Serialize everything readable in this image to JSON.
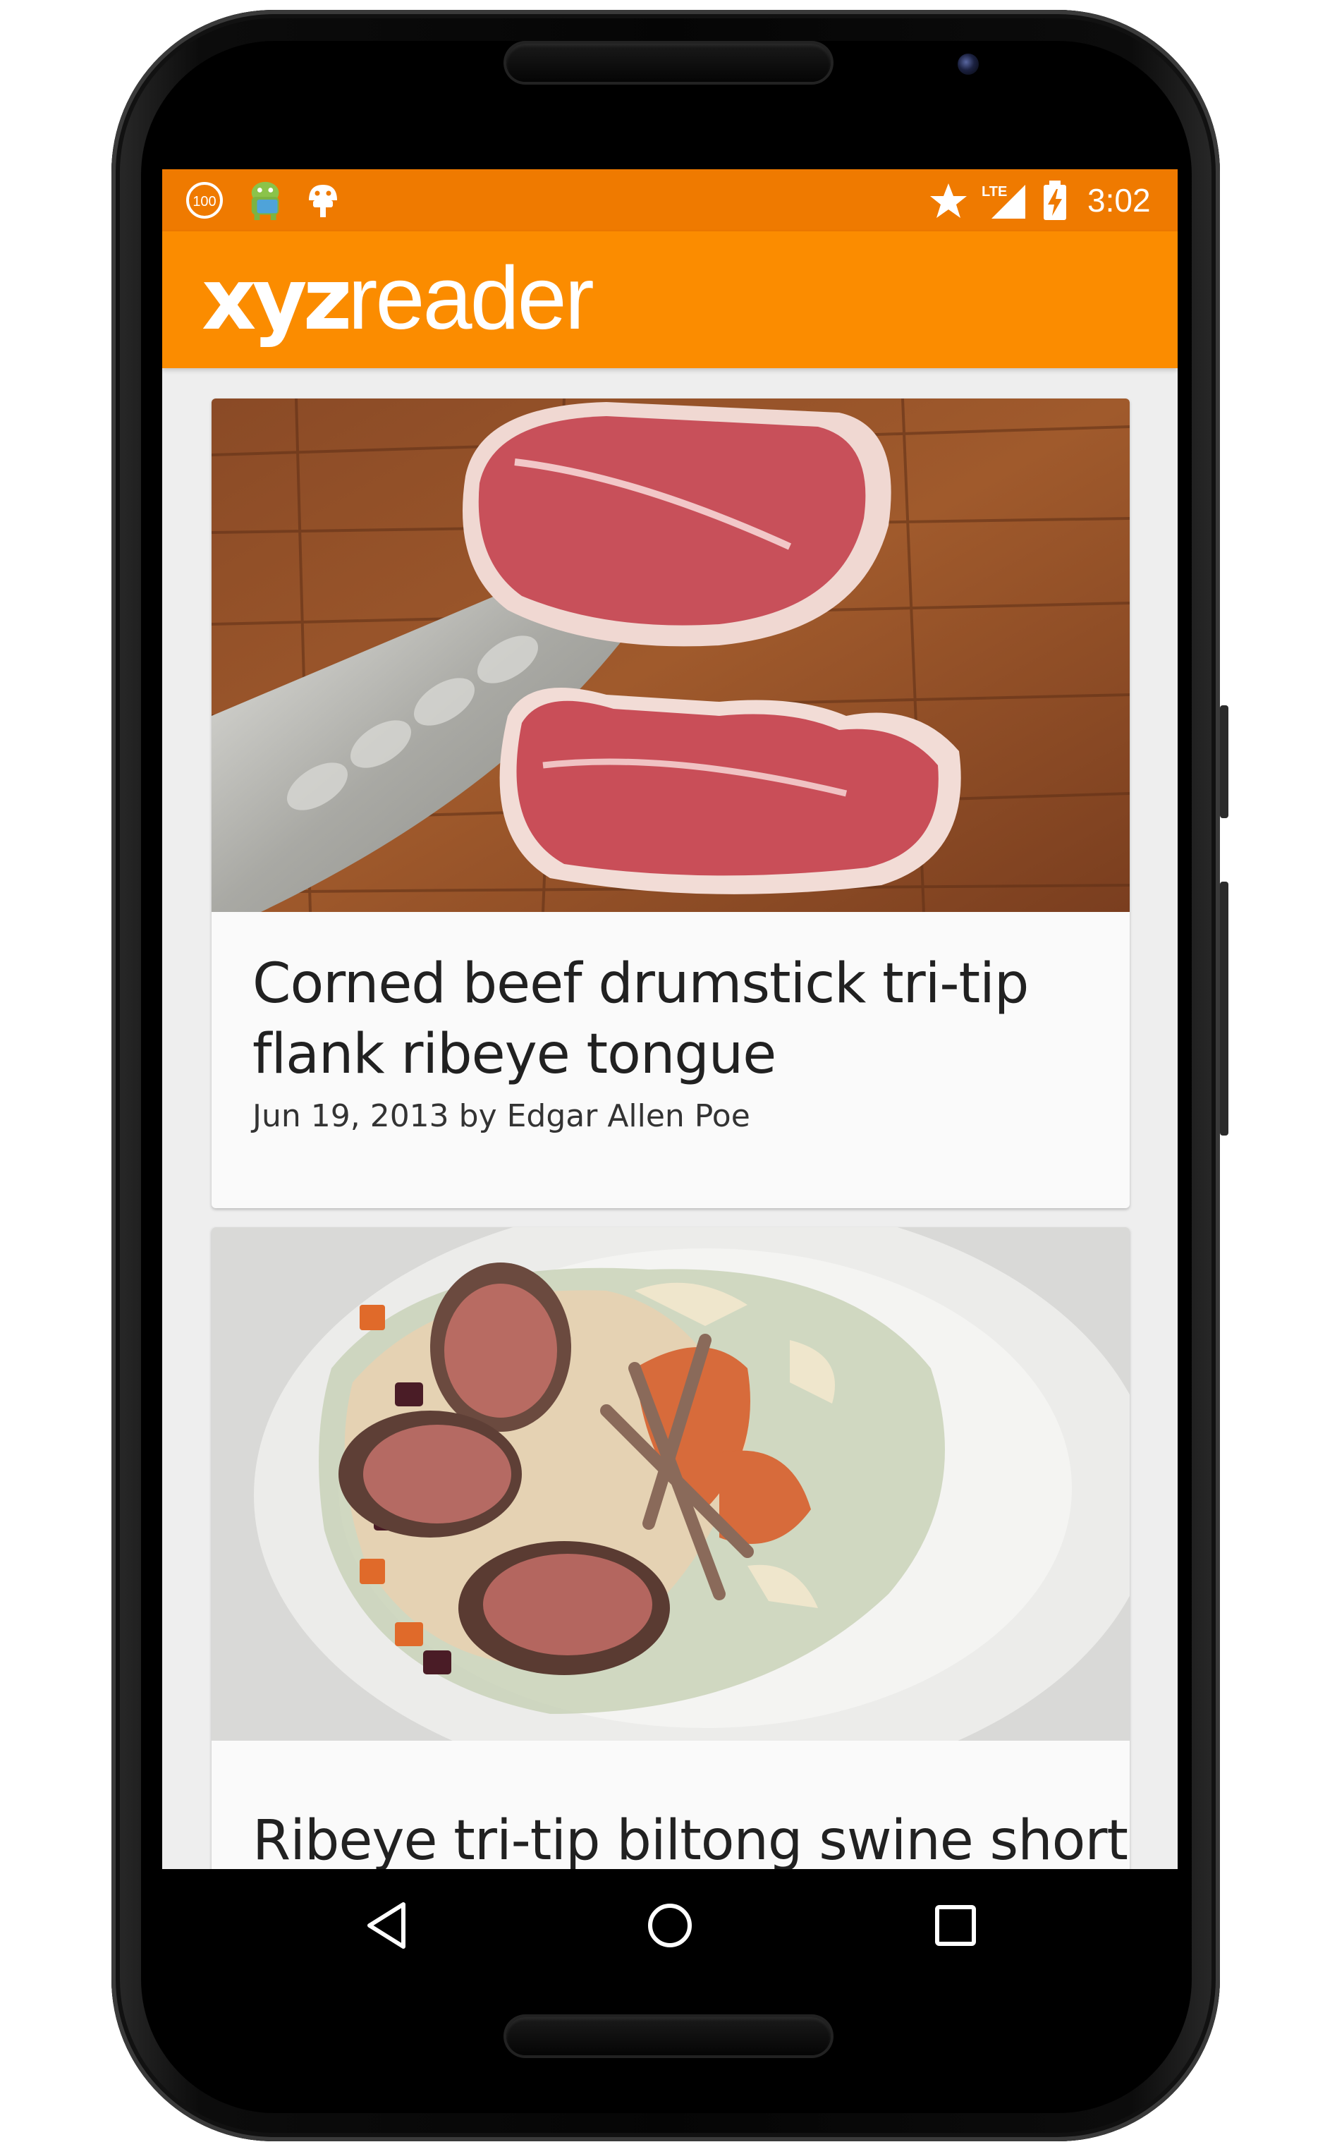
{
  "status_bar": {
    "time": "3:02",
    "icons": [
      "battery-saver-icon",
      "android-robot-icon",
      "bug-icon",
      "star-icon",
      "lte-signal-icon",
      "battery-icon"
    ],
    "battery_saver_label": "100",
    "network_label": "LTE"
  },
  "app_bar": {
    "logo_bold": "xyz",
    "logo_light": "reader"
  },
  "articles": [
    {
      "title": "Corned beef drumstick tri-tip flank ribeye tongue",
      "meta": "Jun 19, 2013 by Edgar Allen Poe",
      "image": "raw-steaks-on-cutting-board"
    },
    {
      "title": "Ribeye tri-tip biltong swine short",
      "image": "plated-lamb-dish"
    }
  ],
  "nav_bar": {
    "buttons": [
      "back-icon",
      "home-icon",
      "recents-icon"
    ]
  },
  "colors": {
    "status_bar": "#ef7a00",
    "app_bar": "#fb8c00",
    "background": "#eeeeee",
    "card": "#fafafa"
  }
}
